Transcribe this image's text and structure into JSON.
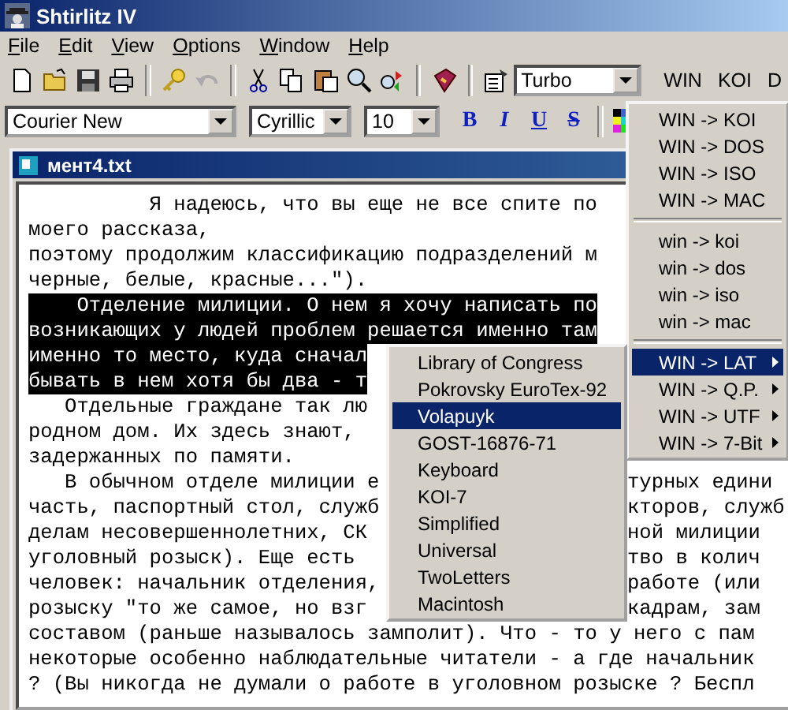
{
  "window": {
    "title": "Shtirlitz IV"
  },
  "menu_bar": [
    "File",
    "Edit",
    "View",
    "Options",
    "Window",
    "Help"
  ],
  "toolbar": {
    "speed_combo": "Turbo",
    "charset_buttons": [
      "WIN",
      "KOI",
      "D"
    ]
  },
  "format_bar": {
    "font": "Courier New",
    "script": "Cyrillic",
    "size": "10",
    "style_buttons": [
      "B",
      "I",
      "U",
      "S"
    ]
  },
  "document": {
    "title": "мент4.txt",
    "lines": [
      {
        "text": "          Я надеюсь, что вы еще не все спите по",
        "selected": false
      },
      {
        "text": "моего рассказа,",
        "selected": false
      },
      {
        "text": "поэтому продолжим классификацию подразделений м",
        "selected": false
      },
      {
        "text": "черные, белые, красные...\").",
        "selected": false
      },
      {
        "text": "    Отделение милиции. О нем я хочу написать по",
        "selected": true
      },
      {
        "text": "возникающих у людей проблем решается именно там",
        "selected": true
      },
      {
        "text": "именно то место, куда сначал",
        "selected": true
      },
      {
        "text": "бывать в нем хотя бы два - т",
        "selected": true
      },
      {
        "text": "   Отдельные граждане так лю",
        "selected": false
      },
      {
        "text": "родном дом. Их здесь знают,",
        "selected": false
      },
      {
        "text": "задержанных по памяти.",
        "selected": false
      },
      {
        "text": "   В обычном отделе милиции е",
        "selected": false,
        "right": "турных едини"
      },
      {
        "text": "часть, паспортный стол, служб",
        "selected": false,
        "right": "кторов, служб"
      },
      {
        "text": "делам несовершеннолетних, СК",
        "selected": false,
        "right": "ной милиции"
      },
      {
        "text": "уголовный розыск). Еще есть",
        "selected": false,
        "right": "тво в колич"
      },
      {
        "text": "человек: начальник отделения,",
        "selected": false,
        "right": "работе (или"
      },
      {
        "text": "розыску \"то же самое, но взг",
        "selected": false,
        "right": "кадрам, зам"
      },
      {
        "text": "составом (раньше называлось замполит). Что - то у него с пам",
        "selected": false
      },
      {
        "text": "некоторые особенно наблюдательные читатели - а где начальник",
        "selected": false
      },
      {
        "text": "? (Вы никогда не думали о работе в уголовном розыске ? Беспл",
        "selected": false
      }
    ]
  },
  "convert_menu": {
    "groups": [
      [
        {
          "label": "WIN -> KOI",
          "selected": false,
          "submenu": false
        },
        {
          "label": "WIN -> DOS",
          "selected": false,
          "submenu": false
        },
        {
          "label": "WIN -> ISO",
          "selected": false,
          "submenu": false
        },
        {
          "label": "WIN -> MAC",
          "selected": false,
          "submenu": false
        }
      ],
      [
        {
          "label": "win -> koi",
          "selected": false,
          "submenu": false
        },
        {
          "label": "win -> dos",
          "selected": false,
          "submenu": false
        },
        {
          "label": "win -> iso",
          "selected": false,
          "submenu": false
        },
        {
          "label": "win -> mac",
          "selected": false,
          "submenu": false
        }
      ],
      [
        {
          "label": "WIN -> LAT",
          "selected": true,
          "submenu": true
        },
        {
          "label": "WIN -> Q.P.",
          "selected": false,
          "submenu": true
        },
        {
          "label": "WIN -> UTF",
          "selected": false,
          "submenu": true
        },
        {
          "label": "WIN -> 7-Bit",
          "selected": false,
          "submenu": true
        }
      ]
    ]
  },
  "lat_submenu": {
    "items": [
      {
        "label": "Library of Congress",
        "selected": false
      },
      {
        "label": "Pokrovsky EuroTex-92",
        "selected": false
      },
      {
        "label": "Volapuyk",
        "selected": true
      },
      {
        "label": "GOST-16876-71",
        "selected": false
      },
      {
        "label": "Keyboard",
        "selected": false
      },
      {
        "label": "KOI-7",
        "selected": false
      },
      {
        "label": "Simplified",
        "selected": false
      },
      {
        "label": "Universal",
        "selected": false
      },
      {
        "label": "TwoLetters",
        "selected": false
      },
      {
        "label": "Macintosh",
        "selected": false
      }
    ]
  }
}
